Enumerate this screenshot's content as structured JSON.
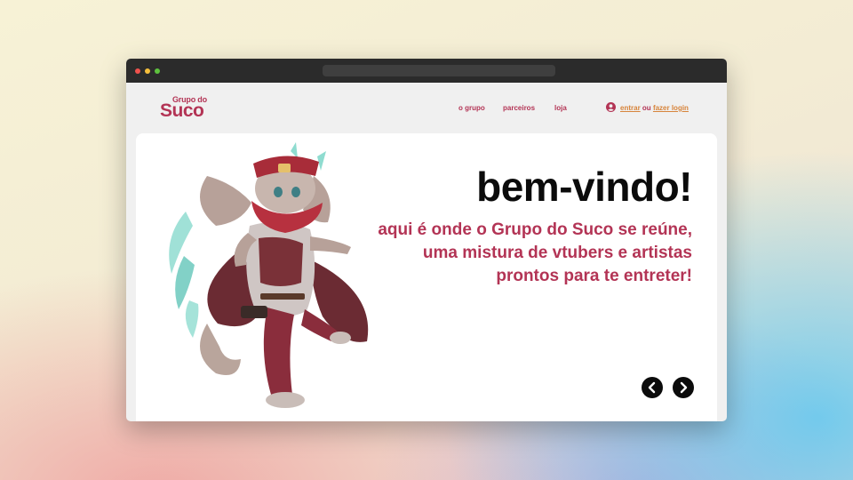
{
  "brand": {
    "name_small": "Grupo do",
    "name_big": "Suco",
    "accent_color": "#b33455",
    "link_color": "#d7843b"
  },
  "nav": {
    "links": [
      "o grupo",
      "parceiros",
      "loja"
    ]
  },
  "login": {
    "icon": "user-icon",
    "enter": "entrar",
    "or": "ou",
    "sign_in": "fazer login"
  },
  "hero": {
    "headline": "bem-vindo!",
    "tagline_lines": [
      "aqui é onde o Grupo do Suco se reúne,",
      "uma mistura de vtubers e artistas",
      "prontos para te entreter!"
    ],
    "prev_icon": "chevron-left-icon",
    "next_icon": "chevron-right-icon"
  }
}
